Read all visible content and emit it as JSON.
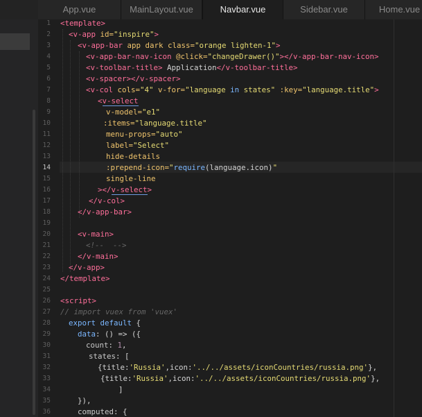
{
  "tabs": [
    {
      "label": "App.vue",
      "active": false
    },
    {
      "label": "MainLayout.vue",
      "active": false
    },
    {
      "label": "Navbar.vue",
      "active": true
    },
    {
      "label": "Sidebar.vue",
      "active": false
    },
    {
      "label": "Home.vue",
      "active": false
    }
  ],
  "editor": {
    "current_line": 14,
    "line_numbers": [
      "1",
      "2",
      "3",
      "4",
      "5",
      "6",
      "7",
      "8",
      "9",
      "10",
      "11",
      "12",
      "13",
      "14",
      "15",
      "16",
      "17",
      "18",
      "19",
      "20",
      "21",
      "22",
      "23",
      "24",
      "25",
      "26",
      "27",
      "28",
      "29",
      "30",
      "31",
      "32",
      "33",
      "34",
      "35",
      "36"
    ]
  },
  "code": {
    "l1": {
      "t1": "<template>"
    },
    "l2": {
      "t1": "<v-app ",
      "a1": "id=",
      "s1": "\"inspire\"",
      "t2": ">"
    },
    "l3": {
      "t1": "<v-app-bar ",
      "a1": "app dark class=",
      "s1": "\"orange lighten-1\"",
      "t2": ">"
    },
    "l4": {
      "t1": "<v-app-bar-nav-icon ",
      "a1": "@click=",
      "s1": "\"changeDrawer()\"",
      "t2": "></v-app-bar-nav-icon>"
    },
    "l5": {
      "t1": "<v-toolbar-title>",
      "x1": " Application",
      "t2": "</v-toolbar-title>"
    },
    "l6": {
      "t1": "<v-spacer></v-spacer>"
    },
    "l7": {
      "t1": "<v-col ",
      "a1": "cols=",
      "s1": "\"4\"",
      "a2": " v-for=",
      "s2": "\"language ",
      "k1": "in",
      "s3": " states\"",
      "a3": " :key=",
      "s4": "\"language.title\"",
      "t2": ">"
    },
    "l8": {
      "t1": "<",
      "t2": "v-select"
    },
    "l9": {
      "a1": "v-model=",
      "s1": "\"e1\""
    },
    "l10": {
      "a1": ":items=",
      "s1": "\"language.title\""
    },
    "l11": {
      "a1": "menu-props=",
      "s1": "\"auto\""
    },
    "l12": {
      "a1": "label=",
      "s1": "\"Select\""
    },
    "l13": {
      "a1": "hide-details"
    },
    "l14": {
      "a1": ":prepend-icon=",
      "s1": "\"",
      "k1": "require",
      "x1": "(language.icon)",
      "s2": "\""
    },
    "l15": {
      "a1": "single-line"
    },
    "l16": {
      "t1": "></",
      "t2": "v-select",
      "t3": ">"
    },
    "l17": {
      "t1": "</v-col>"
    },
    "l18": {
      "t1": "</v-app-bar>"
    },
    "l20": {
      "t1": "<v-main>"
    },
    "l21": {
      "c1": "<!--  -->"
    },
    "l22": {
      "t1": "</v-main>"
    },
    "l23": {
      "t1": "</v-app>"
    },
    "l24": {
      "t1": "</template>"
    },
    "l26": {
      "t1": "<script>"
    },
    "l27": {
      "c1": "// import vuex from 'vuex'"
    },
    "l28": {
      "k1": "export default",
      "x1": " {"
    },
    "l29": {
      "k1": "data",
      "x1": ": () => ({"
    },
    "l30": {
      "p1": "count",
      "x1": ": ",
      "n1": "1",
      "x2": ","
    },
    "l31": {
      "p1": "states",
      "x1": ": ["
    },
    "l32": {
      "x1": "{title:",
      "s1": "'Russia'",
      "x2": ",icon:",
      "s2": "'../../assets/iconCountries/russia.png'",
      "x3": "},"
    },
    "l33": {
      "x1": "{title:",
      "s1": "'Russia'",
      "x2": ",icon:",
      "s2": "'../../assets/iconCountries/russia.png'",
      "x3": "},"
    },
    "l34": {
      "x1": "]"
    },
    "l35": {
      "x1": "}),"
    },
    "l36": {
      "p1": "computed",
      "x1": ": {"
    }
  }
}
